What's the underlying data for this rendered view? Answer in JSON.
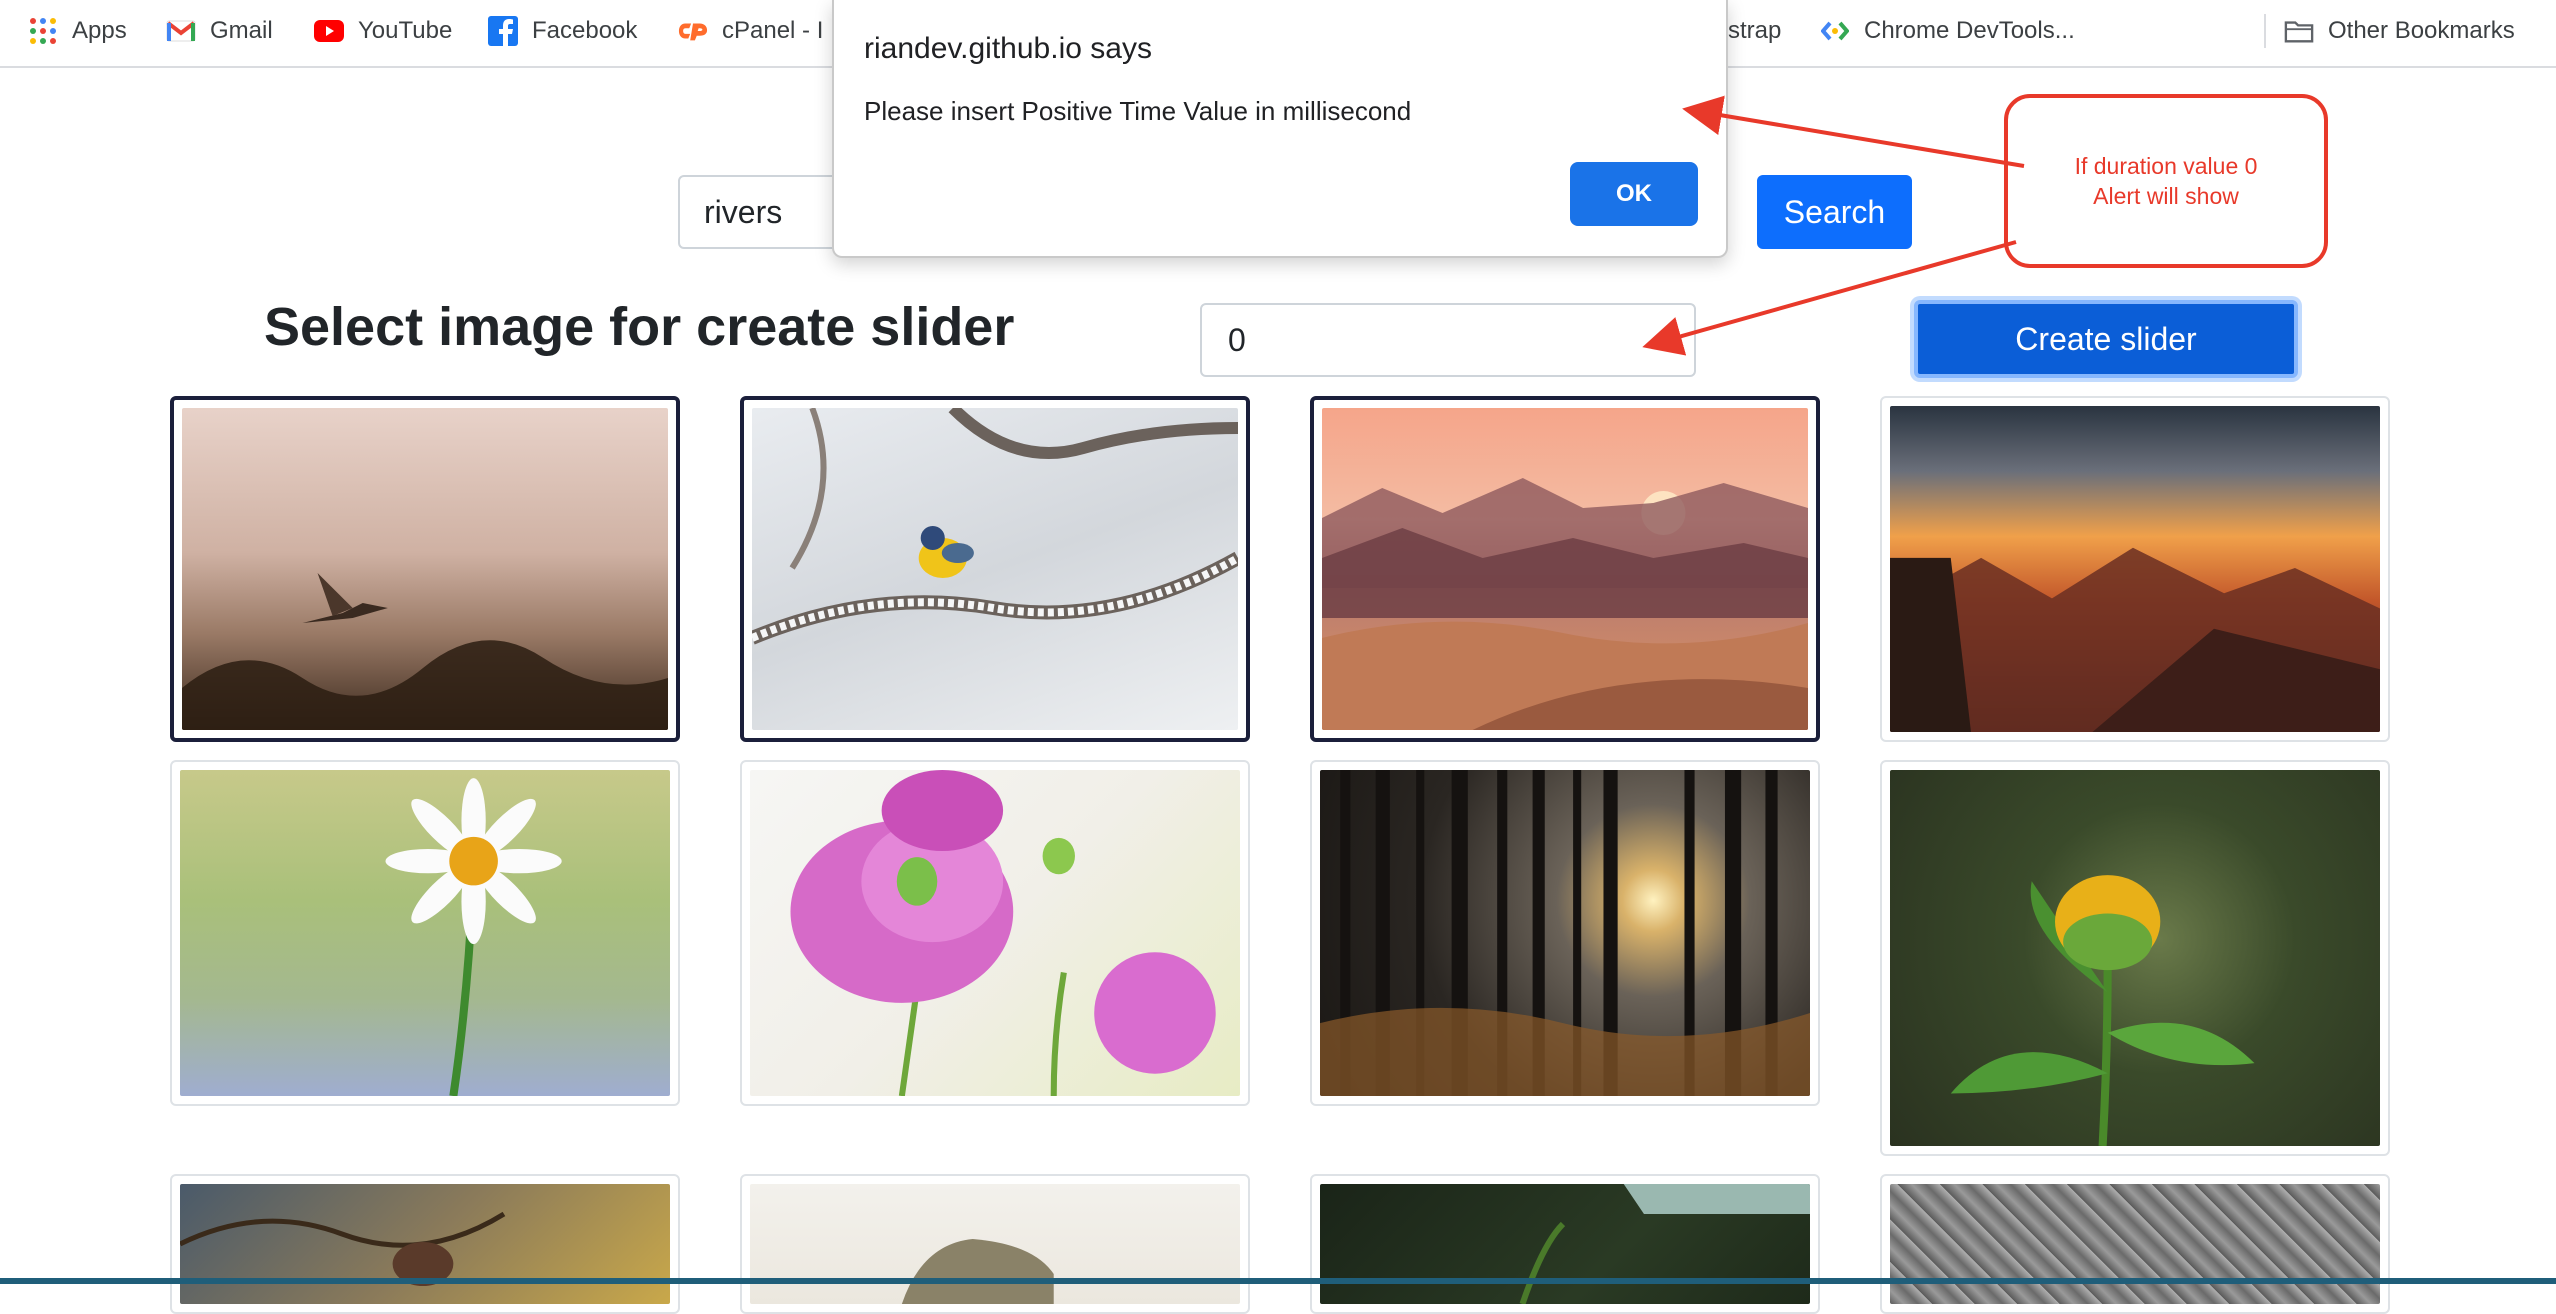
{
  "bookmarks": [
    {
      "label": "Apps",
      "icon": "apps-grid-icon"
    },
    {
      "label": "Gmail",
      "icon": "gmail-icon"
    },
    {
      "label": "YouTube",
      "icon": "youtube-icon"
    },
    {
      "label": "Facebook",
      "icon": "facebook-icon"
    },
    {
      "label": "cPanel - I",
      "icon": "cpanel-icon"
    },
    {
      "label": "strap",
      "icon": ""
    },
    {
      "label": "Chrome DevTools...",
      "icon": "devtools-icon"
    },
    {
      "label": "Other Bookmarks",
      "icon": "folder-icon"
    }
  ],
  "search": {
    "value": "rivers",
    "button_label": "Search"
  },
  "heading": "Select image for create slider",
  "duration": {
    "value": "0"
  },
  "create_button_label": "Create slider",
  "alert": {
    "title": "riandev.github.io says",
    "message": "Please insert Positive Time Value in millisecond",
    "ok_label": "OK"
  },
  "annotation": {
    "line1": "If duration value 0",
    "line2": "Alert will show"
  },
  "images": [
    {
      "name": "bird-in-fog-image",
      "selected": true
    },
    {
      "name": "bird-on-snowy-branch-image",
      "selected": true
    },
    {
      "name": "desert-sunset-image",
      "selected": true
    },
    {
      "name": "mountain-sunset-image",
      "selected": false
    },
    {
      "name": "daisy-flower-image",
      "selected": false
    },
    {
      "name": "pink-poppy-image",
      "selected": false
    },
    {
      "name": "forest-sunlight-image",
      "selected": false
    },
    {
      "name": "yellow-bud-image",
      "selected": false
    },
    {
      "name": "bird-on-branch-image",
      "selected": false
    },
    {
      "name": "shoe-image",
      "selected": false
    },
    {
      "name": "green-object-image",
      "selected": false
    },
    {
      "name": "rope-texture-image",
      "selected": false
    }
  ],
  "colors": {
    "primary": "#0d6efd",
    "alert_button": "#1a73e8",
    "annotation": "#e8392a"
  }
}
